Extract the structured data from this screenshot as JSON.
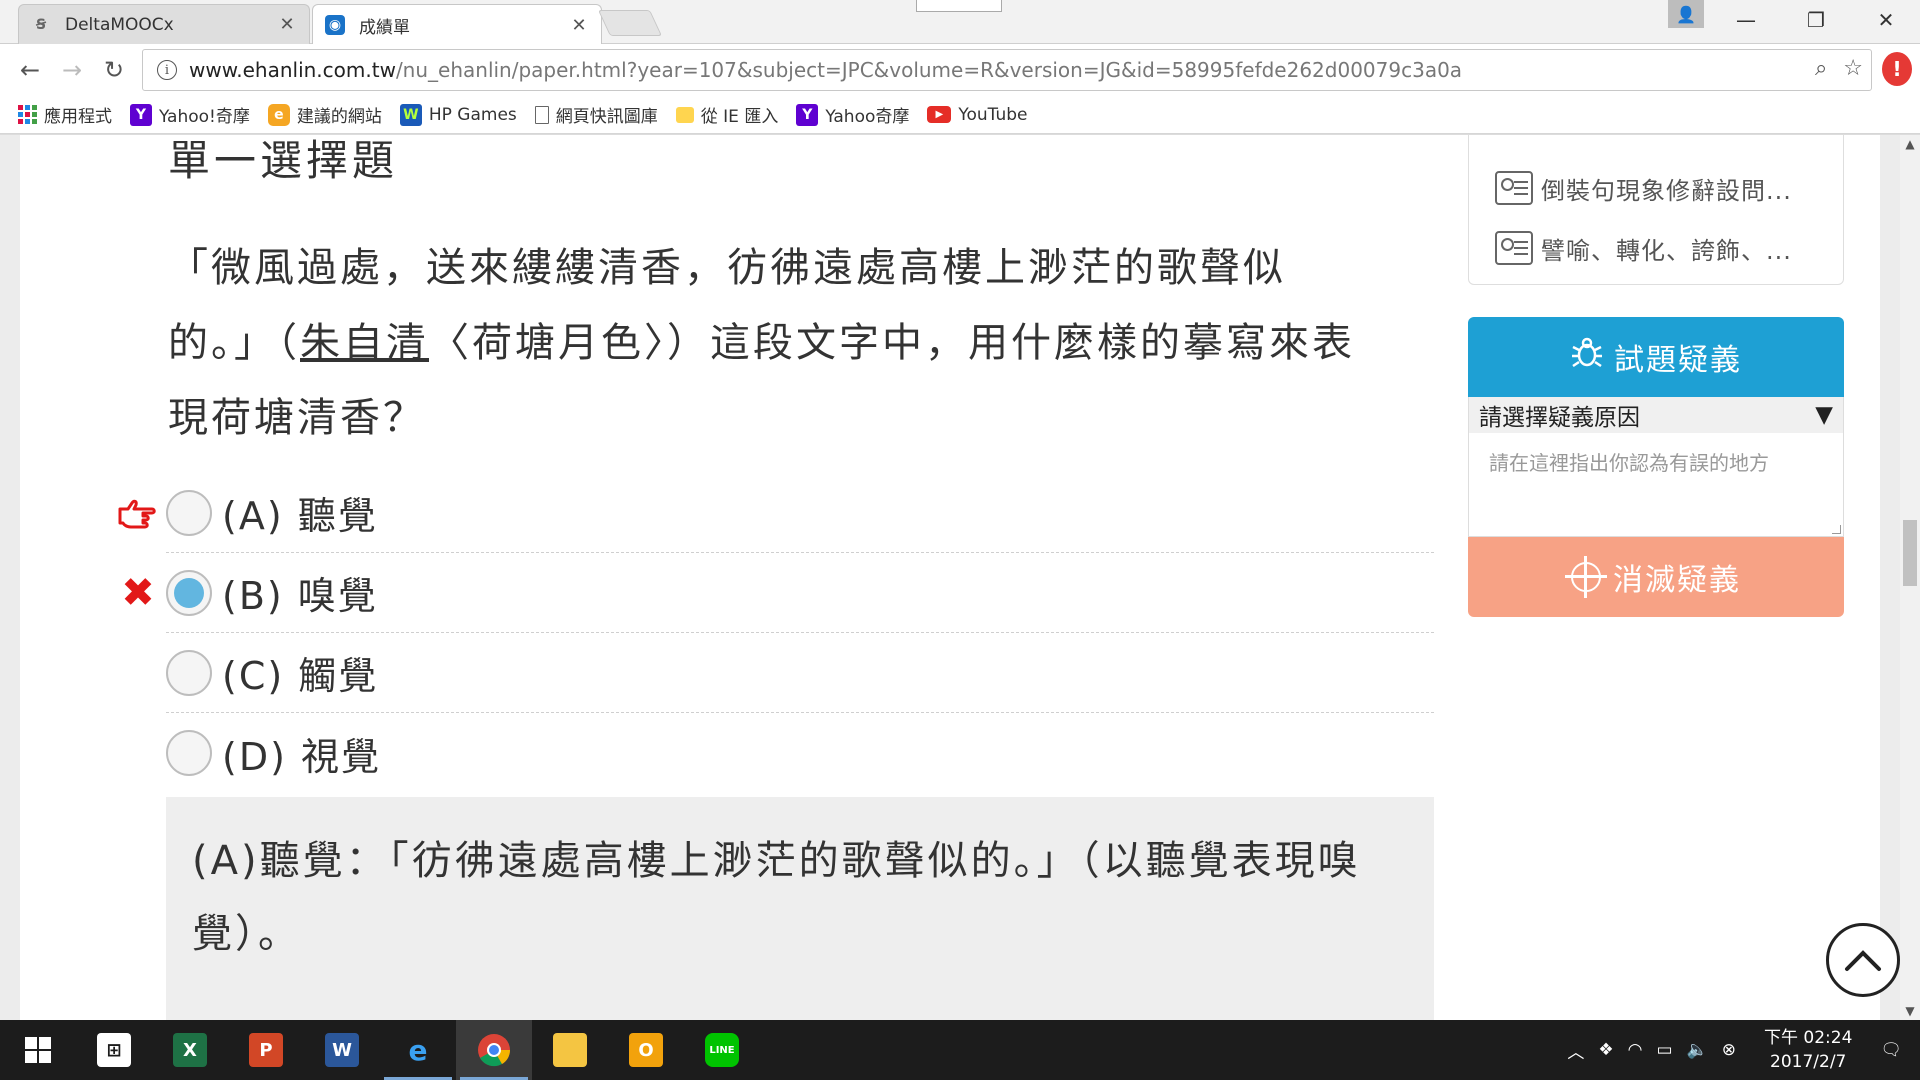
{
  "tabs": [
    {
      "title": "DeltaMOOCx",
      "icon": "scratch-icon"
    },
    {
      "title": "成績單",
      "icon": "ehanlin-icon"
    }
  ],
  "url": {
    "host": "www.ehanlin.com.tw",
    "path": "/nu_ehanlin/paper.html?year=107&subject=JPC&volume=R&version=JG&id=58995fefde262d00079c3a0a"
  },
  "bookmarks": [
    {
      "label": "應用程式",
      "icon": "apps-icon"
    },
    {
      "label": "Yahoo!奇摩",
      "icon": "yahoo-icon"
    },
    {
      "label": "建議的網站",
      "icon": "suggested-sites-icon"
    },
    {
      "label": "HP Games",
      "icon": "hp-games-icon"
    },
    {
      "label": "網頁快訊圖庫",
      "icon": "document-icon"
    },
    {
      "label": "從 IE 匯入",
      "icon": "folder-icon"
    },
    {
      "label": "Yahoo奇摩",
      "icon": "yahoo-icon"
    },
    {
      "label": "YouTube",
      "icon": "youtube-icon"
    }
  ],
  "page": {
    "section_title": "單一選擇題",
    "question": {
      "part1": "「微風過處，送來縷縷清香，彷彿遠處高樓上渺茫的歌聲似的。」（",
      "author": "朱自清",
      "part2": "〈荷塘月色〉）這段文字中，用什麼樣的摹寫來表現荷塘清香？"
    },
    "options": [
      {
        "label": "(A) 聽覺",
        "selected": false,
        "marker": "correct-answer"
      },
      {
        "label": "(B) 嗅覺",
        "selected": true,
        "marker": "wrong-answer"
      },
      {
        "label": "(C) 觸覺",
        "selected": false,
        "marker": ""
      },
      {
        "label": "(D) 視覺",
        "selected": false,
        "marker": ""
      }
    ],
    "explanation": "(A)聽覺：「彷彿遠處高樓上渺茫的歌聲似的。」（以聽覺表現嗅覺）。"
  },
  "sidebar": {
    "concepts": [
      "倒裝句現象修辭設問...",
      "譬喻、轉化、誇飾、..."
    ],
    "question_feedback": {
      "title": "試題疑義",
      "select_placeholder": "請選擇疑義原因",
      "textarea_placeholder": "請在這裡指出你認為有誤的地方",
      "submit_label": "消滅疑義"
    }
  },
  "taskbar": {
    "time": "下午 02:24",
    "date": "2017/2/7"
  },
  "colors": {
    "feedback_header": "#1ea0d4",
    "feedback_submit": "#f7a285",
    "selected_radio": "#62b6e0",
    "wrong_marker": "#e21818"
  }
}
